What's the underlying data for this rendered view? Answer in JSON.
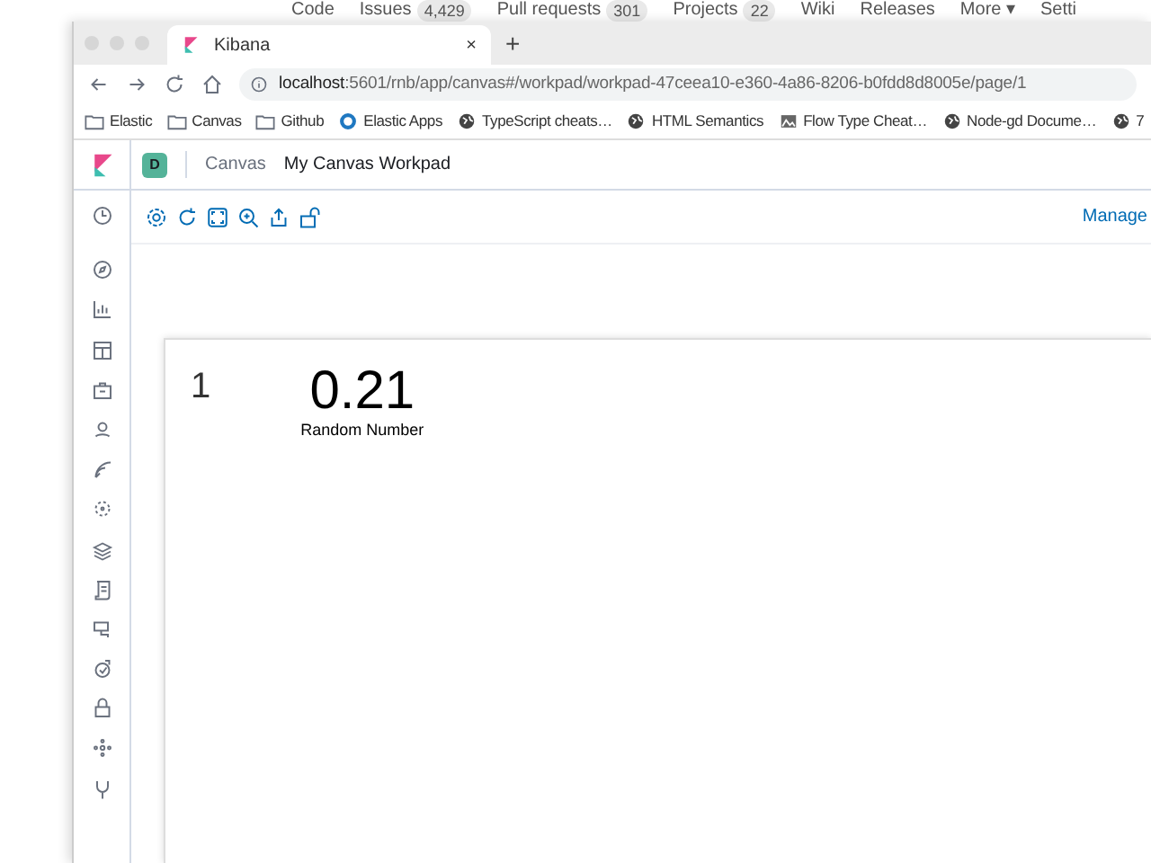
{
  "github_nav": [
    {
      "label": "Code"
    },
    {
      "label": "Issues",
      "count": "4,429"
    },
    {
      "label": "Pull requests",
      "count": "301"
    },
    {
      "label": "Projects",
      "count": "22"
    },
    {
      "label": "Wiki"
    },
    {
      "label": "Releases"
    },
    {
      "label": "More ▾"
    },
    {
      "label": "Setti"
    }
  ],
  "browser": {
    "tabs": [
      {
        "label": "Kibana",
        "selected": true
      }
    ],
    "new_tab": "+",
    "close": "×",
    "address": {
      "host": "localhost",
      "path": ":5601/rnb/app/canvas#/workpad/workpad-47ceea10-e360-4a86-8206-b0fdd8d8005e/page/1"
    },
    "bookmarks": [
      {
        "kind": "folder",
        "label": "Elastic"
      },
      {
        "kind": "folder",
        "label": "Canvas"
      },
      {
        "kind": "folder",
        "label": "Github"
      },
      {
        "kind": "app",
        "label": "Elastic Apps"
      },
      {
        "kind": "globe",
        "label": "TypeScript cheats…"
      },
      {
        "kind": "globe",
        "label": "HTML Semantics"
      },
      {
        "kind": "image",
        "label": "Flow Type Cheat…"
      },
      {
        "kind": "globe",
        "label": "Node-gd Docume…"
      },
      {
        "kind": "globe",
        "label": "7"
      }
    ]
  },
  "kibana": {
    "space": "D",
    "breadcrumbs": [
      "Canvas",
      "My Canvas Workpad"
    ],
    "toolbar_link": "Manage",
    "page": {
      "number": "1",
      "metric": "0.21",
      "metric_label": "Random Number"
    }
  }
}
